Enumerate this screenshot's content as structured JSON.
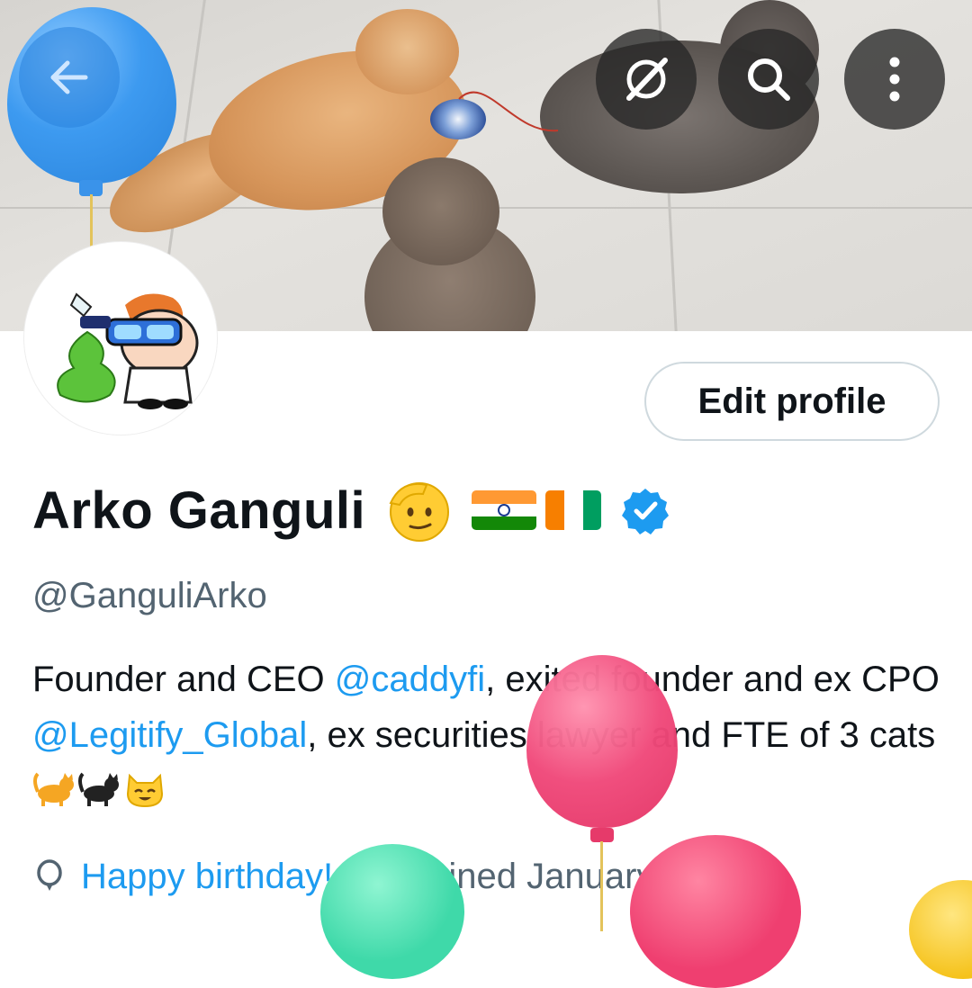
{
  "header": {
    "back_icon": "arrow-left-icon",
    "actions": [
      "grok-icon",
      "search-icon",
      "more-vertical-icon"
    ]
  },
  "profile": {
    "edit_button_label": "Edit profile",
    "display_name": "Arko Ganguli",
    "handle": "@GanguliArko",
    "verified": true,
    "bio": {
      "part1": "Founder and CEO ",
      "mention1": "@caddyfi",
      "part2": ", exited founder and ex CPO ",
      "mention2": "@Legitify_Global",
      "part3": ",  ex securities lawyer and FTE of 3 cats"
    },
    "birthday_label": "Happy birthday!",
    "joined_label": "Joined January 2021"
  },
  "colors": {
    "accent": "#1d9bf0",
    "secondary_text": "#536471",
    "primary_text": "#0f1419"
  }
}
